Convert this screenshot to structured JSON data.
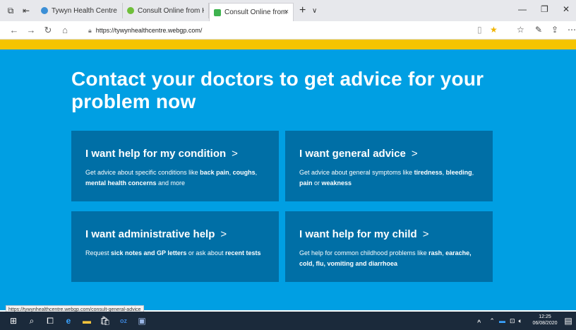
{
  "browser": {
    "tabs": [
      {
        "title": "Tywyn Health Centre | Home",
        "active": false,
        "favicon_color": "#3b8fd6"
      },
      {
        "title": "Consult Online from Home",
        "active": false,
        "favicon_color": "#6fbf3a"
      },
      {
        "title": "Consult Online from Hc",
        "active": true,
        "favicon_color": "#3fb34f"
      }
    ],
    "tab_close_glyph": "×",
    "new_tab_glyph": "+",
    "tab_list_glyph": "∨",
    "url": "https://tywynhealthcentre.webgp.com/",
    "status_url": "https://tywynhealthcentre.webgp.com/consult-general-advice"
  },
  "page": {
    "headline": "Contact your doctors to get advice for your problem now",
    "cards": [
      {
        "title": "I want help for my condition",
        "desc_parts": [
          {
            "t": "Get advice about specific conditions like ",
            "b": false
          },
          {
            "t": "back pain",
            "b": true
          },
          {
            "t": ", ",
            "b": false
          },
          {
            "t": "coughs",
            "b": true
          },
          {
            "t": ", ",
            "b": false
          },
          {
            "t": "mental health concerns",
            "b": true
          },
          {
            "t": " and more",
            "b": false
          }
        ]
      },
      {
        "title": "I want general advice",
        "desc_parts": [
          {
            "t": "Get advice about general symptoms like ",
            "b": false
          },
          {
            "t": "tiredness",
            "b": true
          },
          {
            "t": ", ",
            "b": false
          },
          {
            "t": "bleeding",
            "b": true
          },
          {
            "t": ", ",
            "b": false
          },
          {
            "t": "pain",
            "b": true
          },
          {
            "t": " or ",
            "b": false
          },
          {
            "t": "weakness",
            "b": true
          }
        ]
      },
      {
        "title": "I want administrative help",
        "desc_parts": [
          {
            "t": "Request ",
            "b": false
          },
          {
            "t": "sick notes and GP letters",
            "b": true
          },
          {
            "t": " or ask about ",
            "b": false
          },
          {
            "t": "recent tests",
            "b": true
          }
        ]
      },
      {
        "title": "I want help for my child",
        "desc_parts": [
          {
            "t": "Get help for common childhood problems like ",
            "b": false
          },
          {
            "t": "rash",
            "b": true
          },
          {
            "t": ", ",
            "b": false
          },
          {
            "t": "earache, cold, flu, vomiting and diarrhoea",
            "b": true
          }
        ]
      }
    ],
    "chevron": ">"
  },
  "taskbar": {
    "time": "12:25",
    "date": "06/08/2020"
  },
  "colors": {
    "page_bg": "#009fe3",
    "card_bg": "#006fa6",
    "banner": "#f5c400",
    "taskbar": "#1b2a3b"
  }
}
